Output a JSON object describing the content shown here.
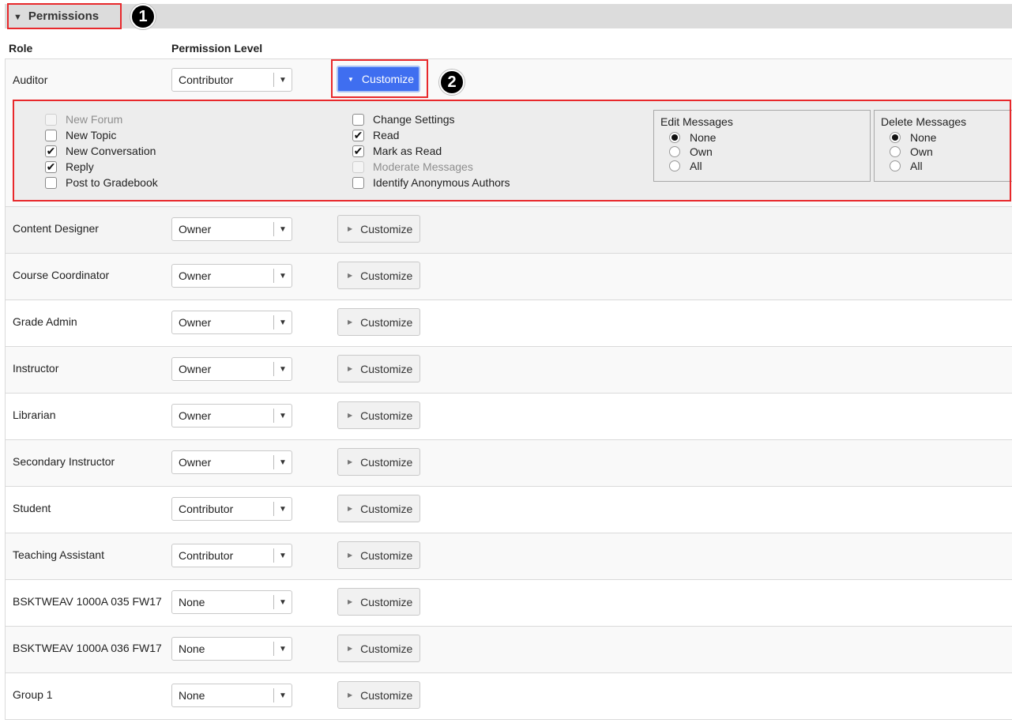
{
  "section": {
    "title": "Permissions",
    "callouts": [
      "1",
      "2"
    ]
  },
  "columns": {
    "role": "Role",
    "permission_level": "Permission Level"
  },
  "customize_label": "Customize",
  "rows": [
    {
      "role": "Auditor",
      "level": "Contributor",
      "expanded": true
    },
    {
      "role": "Content Designer",
      "level": "Owner"
    },
    {
      "role": "Course Coordinator",
      "level": "Owner"
    },
    {
      "role": "Grade Admin",
      "level": "Owner"
    },
    {
      "role": "Instructor",
      "level": "Owner"
    },
    {
      "role": "Librarian",
      "level": "Owner"
    },
    {
      "role": "Secondary Instructor",
      "level": "Owner"
    },
    {
      "role": "Student",
      "level": "Contributor"
    },
    {
      "role": "Teaching Assistant",
      "level": "Contributor"
    },
    {
      "role": "BSKTWEAV 1000A 035 FW17",
      "level": "None"
    },
    {
      "role": "BSKTWEAV 1000A 036 FW17",
      "level": "None"
    },
    {
      "role": "Group 1",
      "level": "None"
    }
  ],
  "customize_panel": {
    "column1": [
      {
        "label": "New Forum",
        "checked": false,
        "disabled": true
      },
      {
        "label": "New Topic",
        "checked": false,
        "disabled": false
      },
      {
        "label": "New Conversation",
        "checked": true,
        "disabled": false
      },
      {
        "label": "Reply",
        "checked": true,
        "disabled": false
      },
      {
        "label": "Post to Gradebook",
        "checked": false,
        "disabled": false
      }
    ],
    "column2": [
      {
        "label": "Change Settings",
        "checked": false,
        "disabled": false
      },
      {
        "label": "Read",
        "checked": true,
        "disabled": false
      },
      {
        "label": "Mark as Read",
        "checked": true,
        "disabled": false
      },
      {
        "label": "Moderate Messages",
        "checked": false,
        "disabled": true
      },
      {
        "label": "Identify Anonymous Authors",
        "checked": false,
        "disabled": false
      }
    ],
    "edit_messages": {
      "legend": "Edit Messages",
      "options": [
        "None",
        "Own",
        "All"
      ],
      "selected": "None"
    },
    "delete_messages": {
      "legend": "Delete Messages",
      "options": [
        "None",
        "Own",
        "All"
      ],
      "selected": "None"
    }
  },
  "colors": {
    "highlight": "#e8282b",
    "active_button": "#3f6ef0"
  }
}
